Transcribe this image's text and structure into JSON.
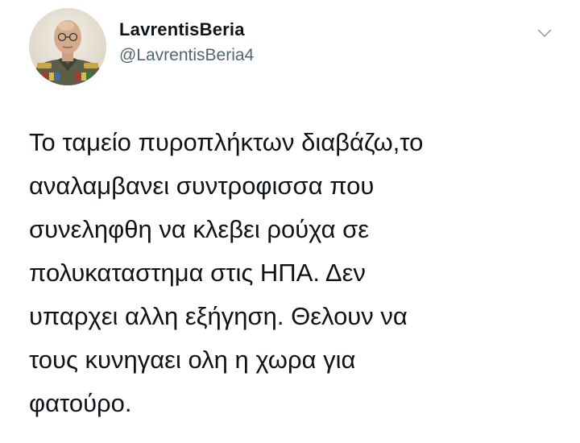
{
  "tweet": {
    "author": {
      "display_name": "LavrentisBeria",
      "handle": "@LavrentisBeria4",
      "avatar_icon": "profile-portrait"
    },
    "menu_icon": "chevron-down-icon",
    "text_lines": [
      "Το ταμείο πυροπλήκτων διαβάζω,το",
      "αναλαμβανει συντροφισσα που",
      "συνεληφθη να κλεβει ρούχα σε",
      "πολυκαταστημα στις ΗΠΑ. Δεν",
      "υπαρχει αλλη εξήγηση. Θελουν να",
      "τους κυνηγαει ολη η χωρα για",
      "φατούρο."
    ]
  }
}
